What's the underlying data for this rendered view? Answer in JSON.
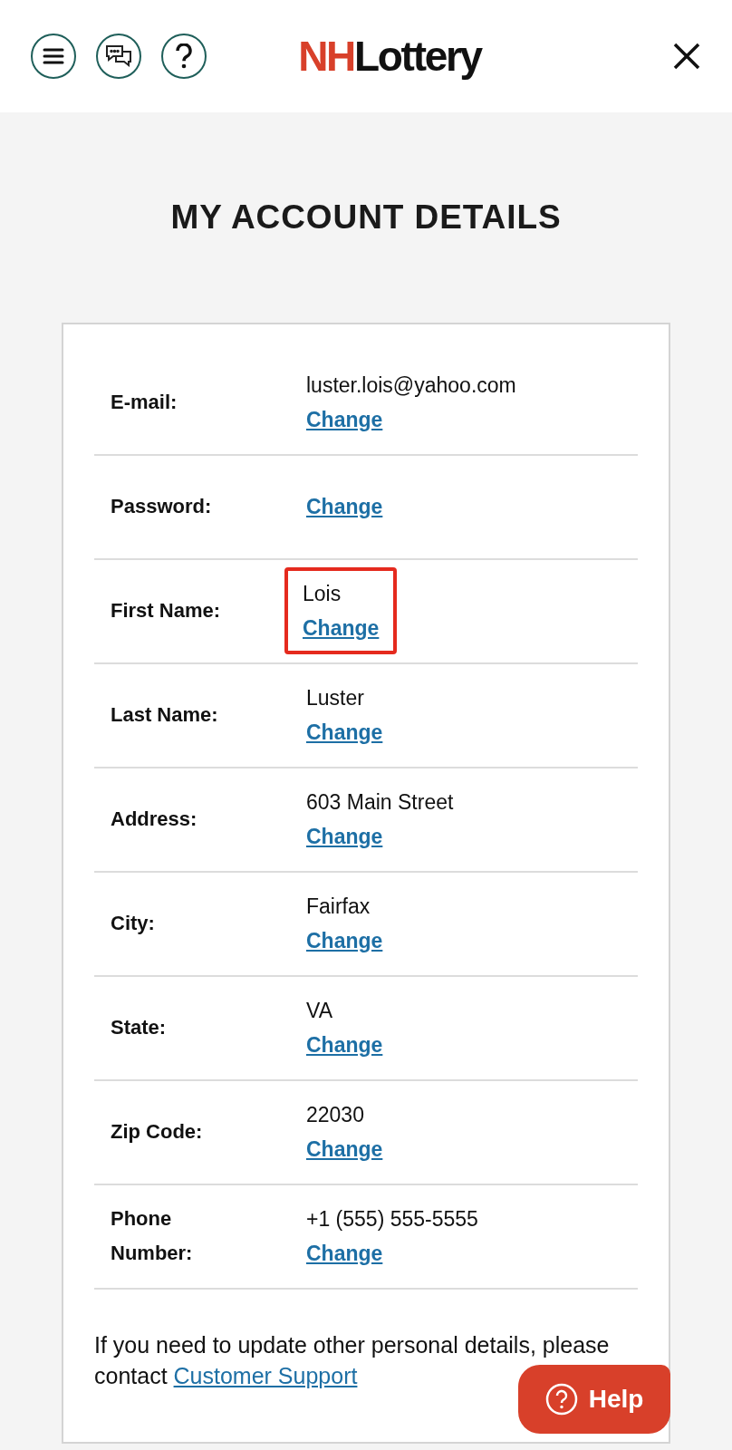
{
  "header": {
    "logo": {
      "part1": "NH",
      "part2": "Lottery"
    }
  },
  "title": "MY ACCOUNT DETAILS",
  "rows": [
    {
      "label": "E-mail:",
      "value": "luster.lois@yahoo.com",
      "action": "Change",
      "highlighted": false
    },
    {
      "label": "Password:",
      "action": "Change",
      "highlighted": false
    },
    {
      "label": "First Name:",
      "value": "Lois",
      "action": "Change",
      "highlighted": true
    },
    {
      "label": "Last Name:",
      "value": "Luster",
      "action": "Change",
      "highlighted": false
    },
    {
      "label": "Address:",
      "value": "603 Main Street",
      "action": "Change",
      "highlighted": false
    },
    {
      "label": "City:",
      "value": "Fairfax",
      "action": "Change",
      "highlighted": false
    },
    {
      "label": "State:",
      "value": "VA",
      "action": "Change",
      "highlighted": false
    },
    {
      "label": "Zip Code:",
      "value": "22030",
      "action": "Change",
      "highlighted": false
    },
    {
      "label": "Phone Number:",
      "value": "+1 (555) 555-5555",
      "action": "Change",
      "highlighted": false
    }
  ],
  "note": {
    "text": "If you need to update other personal details, please contact",
    "link": "Customer Support"
  },
  "help_button": "Help"
}
